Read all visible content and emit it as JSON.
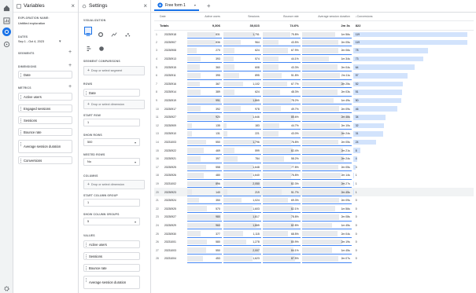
{
  "variables": {
    "title": "Variables",
    "exploration_name_label": "EXPLORATION NAME:",
    "exploration_name": "Untitled exploration",
    "dates_label": "DATES",
    "date_range": "Sep 1 - Oct 4, 2023",
    "segments_label": "SEGMENTS",
    "dimensions_label": "DIMENSIONS",
    "dimensions": [
      "Date"
    ],
    "metrics_label": "METRICS",
    "metrics": [
      "Active users",
      "Engaged sessions",
      "Sessions",
      "Bounce rate",
      "Average session duration",
      "Conversions"
    ]
  },
  "settings": {
    "title": "Settings",
    "visualization_label": "VISUALIZATION",
    "segment_comparisons_label": "SEGMENT COMPARISONS",
    "drop_segment": "Drop or select segment",
    "rows_label": "ROWS",
    "rows": [
      "Date"
    ],
    "drop_dimension": "Drop or select dimension",
    "start_row_label": "START ROW",
    "start_row": "1",
    "show_rows_label": "SHOW ROWS",
    "show_rows": "500",
    "nested_rows_label": "NESTED ROWS",
    "nested_rows": "No",
    "columns_label": "COLUMNS",
    "start_col_label": "START COLUMN GROUP",
    "start_col": "1",
    "show_col_label": "SHOW COLUMN GROUPS",
    "show_col": "5",
    "values_label": "VALUES",
    "values": [
      "Active users",
      "Sessions",
      "Bounce rate",
      "Average session duration"
    ]
  },
  "tab": {
    "name": "Free form 1",
    "add": "+"
  },
  "table": {
    "headers": [
      "Date",
      "Active users",
      "Sessions",
      "Bounce rate",
      "Average session duration",
      "↓Conversions"
    ],
    "totals": {
      "label": "Totals",
      "active": "9,306",
      "sessions": "30,023",
      "bounce": "74.6%",
      "duration": "2m 3s",
      "conv": "822"
    },
    "rows": [
      [
        "1",
        "20230918",
        "831",
        "1,751",
        "75.8%",
        "1m 56s",
        "119"
      ],
      [
        "2",
        "20230907",
        "836",
        "964",
        "43.5%",
        "2m 05s",
        "119"
      ],
      [
        "3",
        "20230908",
        "270",
        "624",
        "67.9%",
        "2m 06s",
        "78"
      ],
      [
        "4",
        "20230913",
        "393",
        "574",
        "44.1%",
        "1m 34s",
        "73"
      ],
      [
        "5",
        "20230915",
        "360",
        "608",
        "43.3%",
        "2m 04s",
        "64"
      ],
      [
        "6",
        "20230911",
        "395",
        "895",
        "51.8%",
        "2m 11s",
        "57"
      ],
      [
        "7",
        "20230916",
        "367",
        "1,102",
        "67.7%",
        "2m 25s",
        "52"
      ],
      [
        "8",
        "20230914",
        "389",
        "624",
        "48.3%",
        "2m 03s",
        "51"
      ],
      [
        "9",
        "20230919",
        "991",
        "1,865",
        "78.2%",
        "1m 49s",
        "50"
      ],
      [
        "10",
        "20230917",
        "392",
        "978",
        "49.7%",
        "2m 09s",
        "46"
      ],
      [
        "11",
        "20230927",
        "920",
        "1,646",
        "85.6%",
        "2m 46s",
        "34"
      ],
      [
        "12",
        "20230909",
        "135",
        "183",
        "44.7%",
        "2m 10s",
        "32"
      ],
      [
        "13",
        "20230910",
        "131",
        "221",
        "43.0%",
        "2m 24s",
        "31"
      ],
      [
        "14",
        "20231003",
        "550",
        "1,796",
        "76.8%",
        "2m 05s",
        "24"
      ],
      [
        "15",
        "20230922",
        "469",
        "599",
        "82.4%",
        "2m 21s",
        "8"
      ],
      [
        "16",
        "20230921",
        "397",
        "784",
        "58.2%",
        "2m 24s",
        "4"
      ],
      [
        "17",
        "20230925",
        "558",
        "1,648",
        "77.8%",
        "2m 05s",
        "3"
      ],
      [
        "18",
        "20230926",
        "480",
        "1,640",
        "76.8%",
        "2m 14s",
        "1"
      ],
      [
        "19",
        "20231002",
        "896",
        "2,050",
        "82.3%",
        "2m 27s",
        "1"
      ],
      [
        "20",
        "20230923",
        "140",
        "219",
        "51.7%",
        "2m 45s",
        "1"
      ],
      [
        "21",
        "20230924",
        "350",
        "1,024",
        "69.3%",
        "2m 09s",
        "0"
      ],
      [
        "22",
        "20230925",
        "570",
        "1,603",
        "82.1%",
        "1m 56s",
        "0"
      ],
      [
        "23",
        "20230927",
        "980",
        "1,817",
        "78.8%",
        "2m 08s",
        "0"
      ],
      [
        "24",
        "20230929",
        "960",
        "1,865",
        "82.8%",
        "1m 45s",
        "0"
      ],
      [
        "25",
        "20230930",
        "377",
        "1,115",
        "68.5%",
        "2m 04s",
        "0"
      ],
      [
        "26",
        "20231001",
        "580",
        "1,278",
        "80.9%",
        "2m 19s",
        "0"
      ],
      [
        "27",
        "20231003",
        "550",
        "2,007",
        "84.1%",
        "1m 45s",
        "0"
      ],
      [
        "28",
        "20231004",
        "453",
        "1,623",
        "87.5%",
        "2m 07s",
        "0"
      ]
    ]
  },
  "colors": {
    "accent": "#1a73e8",
    "bar_blue": "#d2e3fc",
    "bar_grey": "#e8eaed",
    "line": "#4285f4"
  }
}
